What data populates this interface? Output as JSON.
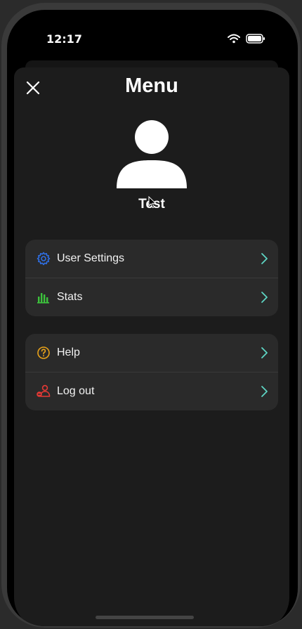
{
  "status_bar": {
    "time": "12:17",
    "wifi_icon": "wifi-icon",
    "battery_icon": "battery-icon"
  },
  "header": {
    "title": "Menu",
    "close_icon": "close-icon"
  },
  "profile": {
    "avatar_icon": "person-icon",
    "name": "Test"
  },
  "groups": [
    {
      "items": [
        {
          "label": "User Settings",
          "icon": "gear-icon",
          "icon_color": "#2f6fe4"
        },
        {
          "label": "Stats",
          "icon": "bar-chart-icon",
          "icon_color": "#3cc23c"
        }
      ]
    },
    {
      "items": [
        {
          "label": "Help",
          "icon": "help-circle-icon",
          "icon_color": "#e8a21a"
        },
        {
          "label": "Log out",
          "icon": "logout-user-icon",
          "icon_color": "#e53935"
        }
      ]
    }
  ],
  "colors": {
    "chevron": "#5ed6c4",
    "sheet_background": "#1c1c1c",
    "row_background": "#2a2a2a"
  }
}
